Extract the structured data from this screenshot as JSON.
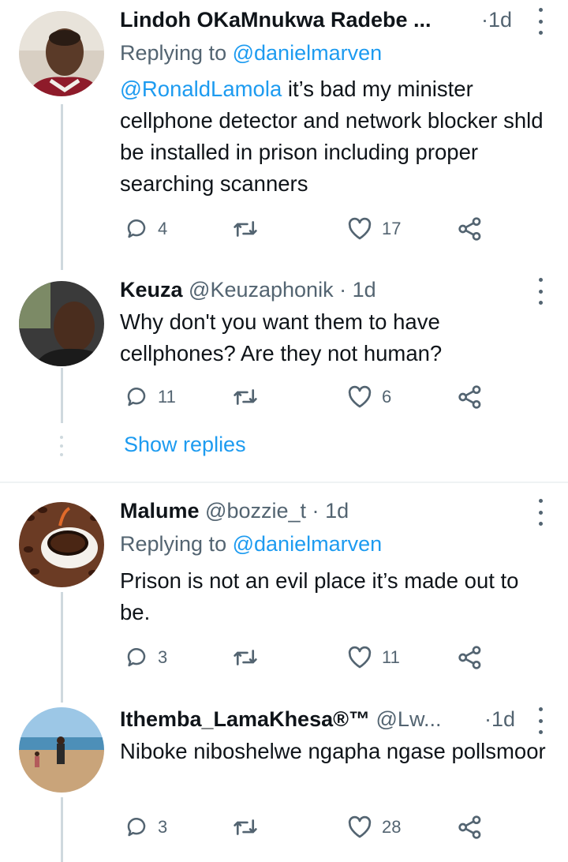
{
  "tweets": [
    {
      "name": "Lindoh OKaMnukwa Radebe ...",
      "handle": "",
      "time": "1d",
      "replying_prefix": "Replying to",
      "replying_to": "@danielmarven",
      "mention": "@RonaldLamola",
      "text": " it’s bad my minister cellphone detector and network blocker shld be installed in prison including proper searching scanners",
      "replies": "4",
      "retweets": "",
      "likes": "17"
    },
    {
      "name": "Keuza",
      "handle": "@Keuzaphonik",
      "time": "1d",
      "text": "Why don't you want them to have cellphones? Are they not human?",
      "replies": "11",
      "retweets": "",
      "likes": "6"
    },
    {
      "name": "Malume",
      "handle": "@bozzie_t",
      "time": "1d",
      "replying_prefix": "Replying to",
      "replying_to": "@danielmarven",
      "text": "Prison is not an evil place it’s made out to be.",
      "replies": "3",
      "retweets": "",
      "likes": "11"
    },
    {
      "name": "Ithemba_LamaKhesa®™",
      "handle": "@Lw...",
      "time": "1d",
      "text": "Niboke niboshelwe ngapha ngase pollsmoor",
      "replies": "3",
      "retweets": "",
      "likes": "28"
    }
  ],
  "show_replies": "Show replies",
  "dot_separator": "·",
  "colors": {
    "link": "#1d9bf0",
    "secondary_text": "#536471",
    "primary_text": "#0f1419",
    "thread_line": "#cfd9de"
  },
  "icons": [
    "reply-icon",
    "retweet-icon",
    "like-icon",
    "share-icon",
    "more-options-icon"
  ]
}
